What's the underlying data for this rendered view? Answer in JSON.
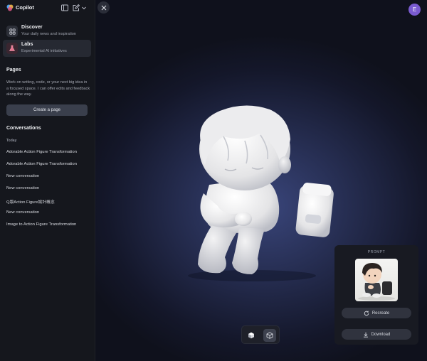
{
  "app": {
    "title": "Copilot"
  },
  "user": {
    "initial": "E"
  },
  "sidebar": {
    "nav": [
      {
        "title": "Discover",
        "subtitle": "Your daily news and inspiration",
        "icon": "grid-icon"
      },
      {
        "title": "Labs",
        "subtitle": "Experimental AI initiatives",
        "icon": "flask-icon"
      }
    ],
    "pages": {
      "heading": "Pages",
      "description": "Work on writing, code, or your next big idea in a focused space. I can offer edits and feedback along the way.",
      "create_label": "Create a page"
    },
    "conversations": {
      "heading": "Conversations",
      "group_label": "Today",
      "items": [
        "Adorable Action Figure Transformation",
        "Adorable Action Figure Transformation",
        "New conversation",
        "New conversation",
        "Q版Action Figure設計概念",
        "New conversation",
        "Image to Action Figure Transformation"
      ]
    }
  },
  "viewer": {
    "prompt_label": "PROMPT",
    "recreate_label": "Recreate",
    "download_label": "Download"
  },
  "colors": {
    "accent": "#7a5bd0",
    "viewer_bg": "#242b4d"
  }
}
